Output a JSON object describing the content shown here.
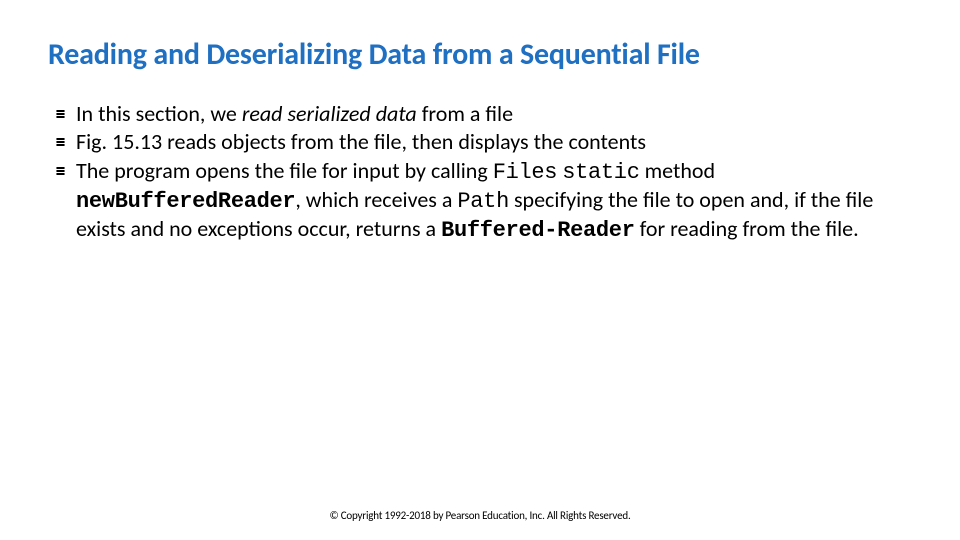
{
  "title": "Reading and Deserializing Data from a Sequential File",
  "bullets": [
    {
      "pre": "In this section, we ",
      "ital": "read serialized data",
      "post": " from a file"
    },
    {
      "text": "Fig. 15.13 reads objects from the file, then displays the contents"
    },
    {
      "p0": "The program opens the file for input by calling ",
      "c0": "Files",
      "p1": " ",
      "c1": "static",
      "p2": " method ",
      "b0": "newBufferedReader",
      "p3": ", which receives a ",
      "c2": "Path",
      "p4": " specifying the file to open and, if the file exists and no exceptions occur, returns a ",
      "b1": "Buffered-Reader",
      "p5": " for reading from the file."
    }
  ],
  "footer": "© Copyright 1992-2018 by Pearson Education, Inc. All Rights Reserved."
}
